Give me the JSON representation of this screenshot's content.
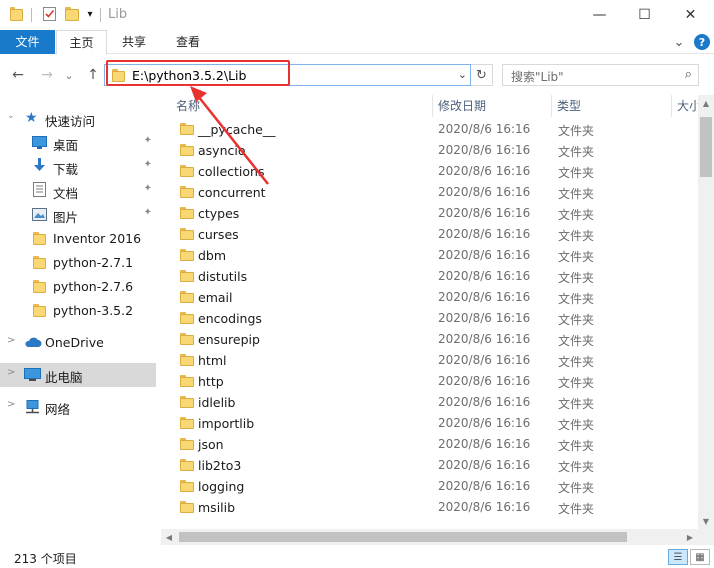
{
  "window": {
    "title": "Lib",
    "minimize_glyph": "—",
    "maximize_glyph": "☐",
    "close_glyph": "✕"
  },
  "ribbon": {
    "tabs": [
      {
        "label": "文件"
      },
      {
        "label": "主页"
      },
      {
        "label": "共享"
      },
      {
        "label": "查看"
      }
    ],
    "expand_glyph": "⌄",
    "help_glyph": "?"
  },
  "nav": {
    "back_glyph": "←",
    "forward_glyph": "→",
    "recent_glyph": "⌄",
    "up_glyph": "↑",
    "address": "E:\\python3.5.2\\Lib",
    "address_dropdown_glyph": "⌄",
    "refresh_glyph": "↻",
    "search_placeholder": "搜索\"Lib\"",
    "search_glyph": "⌕"
  },
  "sidebar": {
    "items": [
      {
        "label": "快速访问",
        "icon": "star-icon"
      },
      {
        "label": "桌面",
        "icon": "desktop-icon"
      },
      {
        "label": "下载",
        "icon": "download-icon"
      },
      {
        "label": "文档",
        "icon": "document-icon"
      },
      {
        "label": "图片",
        "icon": "picture-icon"
      },
      {
        "label": "Inventor 2016",
        "icon": "folder-icon"
      },
      {
        "label": "python-2.7.1",
        "icon": "folder-icon"
      },
      {
        "label": "python-2.7.6",
        "icon": "folder-icon"
      },
      {
        "label": "python-3.5.2",
        "icon": "folder-icon"
      },
      {
        "label": "OneDrive",
        "icon": "cloud-icon"
      },
      {
        "label": "此电脑",
        "icon": "computer-icon"
      },
      {
        "label": "网络",
        "icon": "network-icon"
      }
    ],
    "pin_glyph": "📌",
    "expander_glyph": ">"
  },
  "columns": {
    "name": "名称",
    "modified": "修改日期",
    "type": "类型",
    "size": "大小"
  },
  "files": [
    {
      "name": "__pycache__",
      "modified": "2020/8/6 16:16",
      "type": "文件夹"
    },
    {
      "name": "asyncio",
      "modified": "2020/8/6 16:16",
      "type": "文件夹"
    },
    {
      "name": "collections",
      "modified": "2020/8/6 16:16",
      "type": "文件夹"
    },
    {
      "name": "concurrent",
      "modified": "2020/8/6 16:16",
      "type": "文件夹"
    },
    {
      "name": "ctypes",
      "modified": "2020/8/6 16:16",
      "type": "文件夹"
    },
    {
      "name": "curses",
      "modified": "2020/8/6 16:16",
      "type": "文件夹"
    },
    {
      "name": "dbm",
      "modified": "2020/8/6 16:16",
      "type": "文件夹"
    },
    {
      "name": "distutils",
      "modified": "2020/8/6 16:16",
      "type": "文件夹"
    },
    {
      "name": "email",
      "modified": "2020/8/6 16:16",
      "type": "文件夹"
    },
    {
      "name": "encodings",
      "modified": "2020/8/6 16:16",
      "type": "文件夹"
    },
    {
      "name": "ensurepip",
      "modified": "2020/8/6 16:16",
      "type": "文件夹"
    },
    {
      "name": "html",
      "modified": "2020/8/6 16:16",
      "type": "文件夹"
    },
    {
      "name": "http",
      "modified": "2020/8/6 16:16",
      "type": "文件夹"
    },
    {
      "name": "idlelib",
      "modified": "2020/8/6 16:16",
      "type": "文件夹"
    },
    {
      "name": "importlib",
      "modified": "2020/8/6 16:16",
      "type": "文件夹"
    },
    {
      "name": "json",
      "modified": "2020/8/6 16:16",
      "type": "文件夹"
    },
    {
      "name": "lib2to3",
      "modified": "2020/8/6 16:16",
      "type": "文件夹"
    },
    {
      "name": "logging",
      "modified": "2020/8/6 16:16",
      "type": "文件夹"
    },
    {
      "name": "msilib",
      "modified": "2020/8/6 16:16",
      "type": "文件夹"
    }
  ],
  "status": {
    "item_count": "213 个项目"
  },
  "colors": {
    "accent": "#1979ca",
    "annotation": "#e8322f",
    "folder": "#f8d775"
  }
}
